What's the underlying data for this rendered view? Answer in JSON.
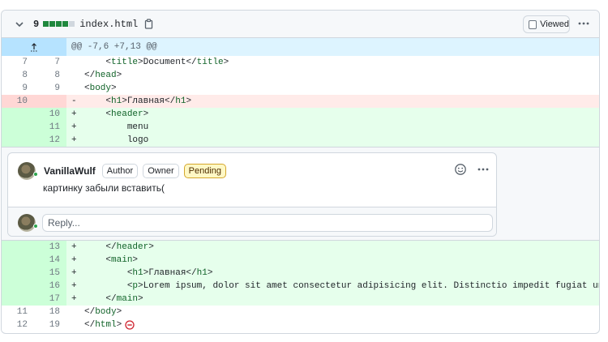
{
  "file_header": {
    "diffstat_count": "9",
    "diffstat_blocks": [
      "add",
      "add",
      "add",
      "add",
      "neutral"
    ],
    "filename": "index.html",
    "viewed_label": "Viewed"
  },
  "hunk": {
    "header": "@@ -7,6 +7,13 @@"
  },
  "lines_before": [
    {
      "type": "ctx",
      "old": "7",
      "new": "7",
      "marker": "",
      "indent": "    ",
      "parts": [
        [
          "p",
          "<"
        ],
        [
          "t",
          "title"
        ],
        [
          "p",
          ">Document</"
        ],
        [
          "t",
          "title"
        ],
        [
          "p",
          ">"
        ]
      ]
    },
    {
      "type": "ctx",
      "old": "8",
      "new": "8",
      "marker": "",
      "indent": "",
      "parts": [
        [
          "p",
          "</"
        ],
        [
          "t",
          "head"
        ],
        [
          "p",
          ">"
        ]
      ]
    },
    {
      "type": "ctx",
      "old": "9",
      "new": "9",
      "marker": "",
      "indent": "",
      "parts": [
        [
          "p",
          "<"
        ],
        [
          "t",
          "body"
        ],
        [
          "p",
          ">"
        ]
      ]
    },
    {
      "type": "del",
      "old": "10",
      "new": "",
      "marker": "-",
      "indent": "    ",
      "parts": [
        [
          "p",
          "<"
        ],
        [
          "t",
          "h1"
        ],
        [
          "p",
          ">Главная</"
        ],
        [
          "t",
          "h1"
        ],
        [
          "p",
          ">"
        ]
      ]
    },
    {
      "type": "add",
      "old": "",
      "new": "10",
      "marker": "+",
      "indent": "    ",
      "parts": [
        [
          "p",
          "<"
        ],
        [
          "t",
          "header"
        ],
        [
          "p",
          ">"
        ]
      ]
    },
    {
      "type": "add",
      "old": "",
      "new": "11",
      "marker": "+",
      "indent": "        ",
      "parts": [
        [
          "p",
          "menu"
        ]
      ]
    },
    {
      "type": "add",
      "old": "",
      "new": "12",
      "marker": "+",
      "indent": "        ",
      "parts": [
        [
          "p",
          "logo"
        ]
      ]
    }
  ],
  "comment": {
    "author": "VanillaWulf",
    "badges": [
      "Author",
      "Owner",
      "Pending"
    ],
    "body": "картинку забыли вставить(",
    "reply_placeholder": "Reply..."
  },
  "lines_after": [
    {
      "type": "add",
      "old": "",
      "new": "13",
      "marker": "+",
      "indent": "    ",
      "parts": [
        [
          "p",
          "</"
        ],
        [
          "t",
          "header"
        ],
        [
          "p",
          ">"
        ]
      ]
    },
    {
      "type": "add",
      "old": "",
      "new": "14",
      "marker": "+",
      "indent": "    ",
      "parts": [
        [
          "p",
          "<"
        ],
        [
          "t",
          "main"
        ],
        [
          "p",
          ">"
        ]
      ]
    },
    {
      "type": "add",
      "old": "",
      "new": "15",
      "marker": "+",
      "indent": "        ",
      "parts": [
        [
          "p",
          "<"
        ],
        [
          "t",
          "h1"
        ],
        [
          "p",
          ">Главная</"
        ],
        [
          "t",
          "h1"
        ],
        [
          "p",
          ">"
        ]
      ]
    },
    {
      "type": "add",
      "old": "",
      "new": "16",
      "marker": "+",
      "indent": "        ",
      "parts": [
        [
          "p",
          "<"
        ],
        [
          "t",
          "p"
        ],
        [
          "p",
          ">Lorem ipsum, dolor sit amet consectetur adipisicing elit. Distinctio impedit fugiat unde beatae qui id"
        ]
      ]
    },
    {
      "type": "add",
      "old": "",
      "new": "17",
      "marker": "+",
      "indent": "    ",
      "parts": [
        [
          "p",
          "</"
        ],
        [
          "t",
          "main"
        ],
        [
          "p",
          ">"
        ]
      ]
    },
    {
      "type": "ctx",
      "old": "11",
      "new": "18",
      "marker": "",
      "indent": "",
      "parts": [
        [
          "p",
          "</"
        ],
        [
          "t",
          "body"
        ],
        [
          "p",
          ">"
        ]
      ]
    },
    {
      "type": "ctx",
      "old": "12",
      "new": "19",
      "marker": "",
      "indent": "",
      "parts": [
        [
          "p",
          "</"
        ],
        [
          "t",
          "html"
        ],
        [
          "p",
          ">"
        ]
      ],
      "no_newline": true
    }
  ],
  "colors": {
    "add_bg": "#e6ffec",
    "add_num_bg": "#ccffd8",
    "del_bg": "#ffebe9",
    "del_num_bg": "#ffd7d5",
    "hunk_bg": "#ddf4ff",
    "tag": "#116329",
    "pending_badge": "#fff8c5",
    "no_newline_icon": "#cf222e"
  },
  "icons": {
    "collapse": "chevron-down-icon",
    "copy": "copy-icon",
    "more": "kebab-horizontal-icon",
    "expand_up": "expand-up-icon",
    "emoji": "smiley-icon",
    "no_newline": "no-entry-icon"
  }
}
